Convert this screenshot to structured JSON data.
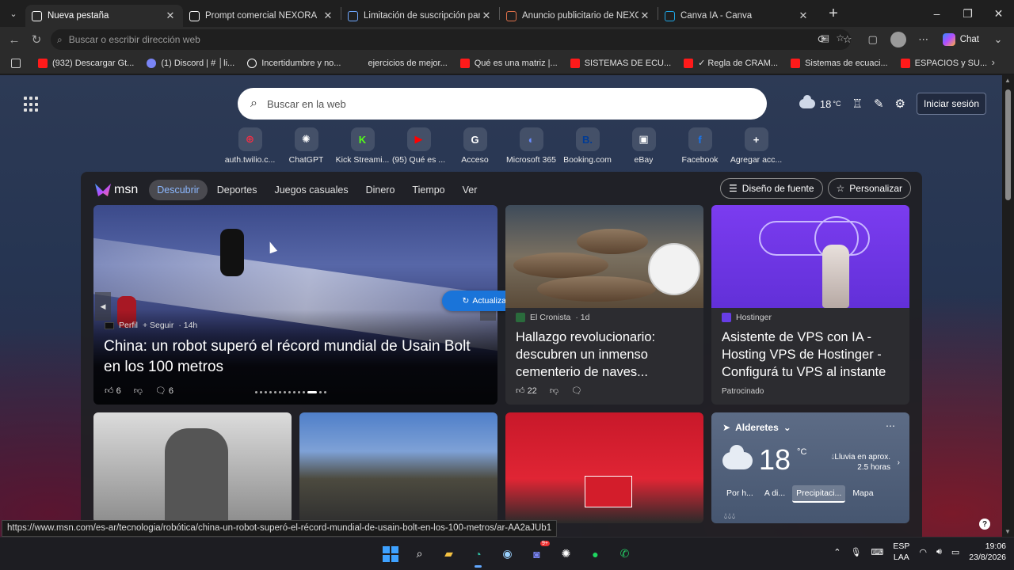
{
  "tabs": [
    {
      "title": "Nueva pestaña",
      "active": true,
      "icon": "newtab-icon",
      "color": "#ffffff"
    },
    {
      "title": "Prompt comercial NEXORA",
      "active": false,
      "icon": "chatgpt-icon",
      "color": "#ffffff"
    },
    {
      "title": "Limitación de suscripción para vid",
      "active": false,
      "icon": "gemini-icon",
      "color": "#6fa8ff"
    },
    {
      "title": "Anuncio publicitario de NEXORA s",
      "active": false,
      "icon": "claude-icon",
      "color": "#e0714a"
    },
    {
      "title": "Canva IA - Canva",
      "active": false,
      "icon": "canva-icon",
      "color": "#1ea7e6"
    }
  ],
  "address": {
    "placeholder": "Buscar o escribir dirección web"
  },
  "toolbar": {
    "chat_label": "Chat"
  },
  "favorites": [
    {
      "label": "(932) Descargar Gt...",
      "icon": "youtube-icon"
    },
    {
      "label": "(1) Discord | # │li...",
      "icon": "discord-icon"
    },
    {
      "label": "Incertidumbre y no...",
      "icon": "chatgpt-icon"
    },
    {
      "label": "ejercicios de mejor...",
      "icon": "search-icon"
    },
    {
      "label": "Qué es una matriz |...",
      "icon": "youtube-icon"
    },
    {
      "label": "SISTEMAS DE ECU...",
      "icon": "youtube-icon"
    },
    {
      "label": "✓ Regla de CRAM...",
      "icon": "youtube-icon"
    },
    {
      "label": "Sistemas de ecuaci...",
      "icon": "youtube-icon"
    },
    {
      "label": "ESPACIOS y SU...",
      "icon": "youtube-icon"
    }
  ],
  "ntp": {
    "search_placeholder": "Buscar en la web",
    "temperature": "18",
    "temp_unit": "°C",
    "signin_label": "Iniciar sesión"
  },
  "quicklinks": [
    {
      "label": "auth.twilio.c...",
      "icon": "twilio-icon",
      "glyph": "⊕",
      "color": "#f22f46"
    },
    {
      "label": "ChatGPT",
      "icon": "chatgpt-icon",
      "glyph": "✺",
      "color": "#ffffff"
    },
    {
      "label": "Kick Streami...",
      "icon": "kick-icon",
      "glyph": "K",
      "color": "#53fc18"
    },
    {
      "label": "(95) Qué es ...",
      "icon": "youtube-icon",
      "glyph": "▶",
      "color": "#ff0000"
    },
    {
      "label": "Acceso",
      "icon": "google-icon",
      "glyph": "G",
      "color": "#ffffff"
    },
    {
      "label": "Microsoft 365",
      "icon": "m365-icon",
      "glyph": "◐",
      "color": "#6a8cff"
    },
    {
      "label": "Booking.com",
      "icon": "booking-icon",
      "glyph": "B.",
      "color": "#003b95"
    },
    {
      "label": "eBay",
      "icon": "ebay-icon",
      "glyph": "▣",
      "color": "#ffffff"
    },
    {
      "label": "Facebook",
      "icon": "facebook-icon",
      "glyph": "f",
      "color": "#1877f2"
    },
    {
      "label": "Agregar acc...",
      "icon": "plus-icon",
      "glyph": "+",
      "color": "#ffffff"
    }
  ],
  "feed": {
    "logo": "msn",
    "nav": [
      "Descubrir",
      "Deportes",
      "Juegos casuales",
      "Dinero",
      "Tiempo",
      "Ver"
    ],
    "active_nav": "Descubrir",
    "layout_button": "Diseño de fuente",
    "personalize_button": "Personalizar",
    "refresh_label": "Actualizar historias",
    "hero": {
      "source": "Perfil",
      "follow": "+ Seguir",
      "age": "· 14h",
      "title": "China: un robot superó el récord mundial de Usain Bolt en los 100 metros",
      "likes": "6",
      "comments": "6"
    },
    "card2": {
      "source": "El Cronista",
      "age": "· 1d",
      "title": "Hallazgo revolucionario: descubren un inmenso cementerio de naves...",
      "likes": "22"
    },
    "card3": {
      "source": "Hostinger",
      "title": "Asistente de VPS con IA - Hosting VPS de Hostinger - Configurá tu VPS al instante",
      "sponsored": "Patrocinado"
    },
    "weather": {
      "location": "Alderetes",
      "temp": "18",
      "unit": "°C",
      "rain_line1": "Lluvia en aprox.",
      "rain_line2": "2.5 horas",
      "tabs": [
        "Por h...",
        "A di...",
        "Precipitaci...",
        "Mapa"
      ],
      "selected_tab": "Precipitaci..."
    }
  },
  "status_url": "https://www.msn.com/es-ar/tecnologia/robótica/china-un-robot-superó-el-récord-mundial-de-usain-bolt-en-los-100-metros/ar-AA2aJUb1",
  "taskbar": {
    "lang_line1": "ESP",
    "lang_line2": "LAA",
    "time": "19:06",
    "date": "23/8/2026",
    "discord_badge": "9+"
  }
}
